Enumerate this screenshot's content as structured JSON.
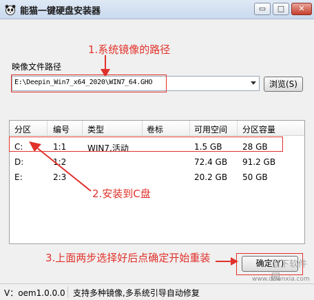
{
  "window": {
    "title": "能猫一键硬盘安装器",
    "min_glyph": "▭",
    "max_glyph": "□",
    "close_glyph": "✕"
  },
  "annotations": {
    "step1": "1.系统镜像的路径",
    "step2": "2.安装到C盘",
    "step3": "3.上面两步选择好后点确定开始重装",
    "color": "#e0312a"
  },
  "path": {
    "label": "映像文件路径",
    "value": "E:\\Deepin_Win7_x64_2020\\WIN7_64.GHO",
    "browse_label": "浏览(S)"
  },
  "table": {
    "headers": [
      "分区",
      "编号",
      "类型",
      "卷标",
      "可用空间",
      "分区容量"
    ],
    "rows": [
      [
        "C:",
        "1:1",
        "WIN7,活动",
        "",
        "1.5 GB",
        "28 GB"
      ],
      [
        "D:",
        "1:2",
        "",
        "",
        "72.4 GB",
        "91.2 GB"
      ],
      [
        "E:",
        "2:3",
        "",
        "",
        "20.2 GB",
        "50 GB"
      ]
    ]
  },
  "ok_label": "确定(Y)",
  "watermark": {
    "text": "当下软件园",
    "url": "www.downxia.com"
  },
  "status": {
    "version": "V：oem1.0.0.0",
    "message": "支持多种镜像,多系统引导自动修复"
  }
}
